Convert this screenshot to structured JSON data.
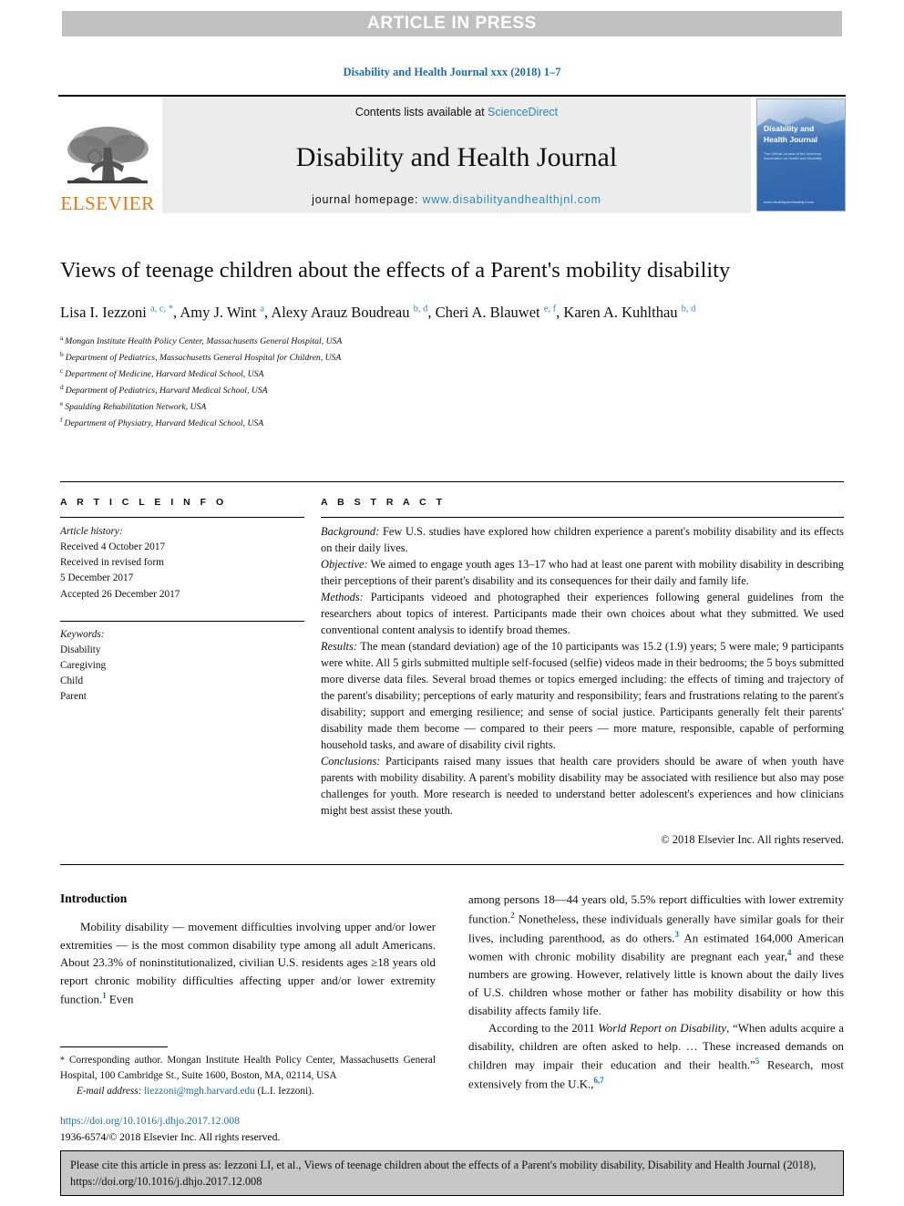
{
  "banner": {
    "label": "ARTICLE IN PRESS"
  },
  "running_head": {
    "text": "Disability and Health Journal xxx (2018) 1–7"
  },
  "masthead": {
    "publisher_name": "ELSEVIER",
    "contents_prefix": "Contents lists available at ",
    "contents_link": "ScienceDirect",
    "journal_name": "Disability and Health Journal",
    "homepage_prefix": "journal homepage: ",
    "homepage_url": "www.disabilityandhealthjnl.com",
    "cover": {
      "title_line1": "Disability and",
      "title_line2": "Health Journal",
      "subtitle": "The Official Journal of the American Association on Health and Disability",
      "footer": "www.disabilityandhealthjnl.com"
    },
    "accent_color": "#2b8ab5",
    "elsevier_orange": "#e77817"
  },
  "article": {
    "title": "Views of teenage children about the effects of a Parent's mobility disability",
    "authors_html": "Lisa I. Iezzoni <sup>a, c, *</sup>, Amy J. Wint <sup>a</sup>, Alexy Arauz Boudreau <sup>b, d</sup>, Cheri A. Blauwet <sup>e, f</sup>, Karen A. Kuhlthau <sup>b, d</sup>",
    "affiliations": [
      {
        "label": "a",
        "text": "Mongan Institute Health Policy Center, Massachusetts General Hospital, USA"
      },
      {
        "label": "b",
        "text": "Department of Pediatrics, Massachusetts General Hospital for Children, USA"
      },
      {
        "label": "c",
        "text": "Department of Medicine, Harvard Medical School, USA"
      },
      {
        "label": "d",
        "text": "Department of Pediatrics, Harvard Medical School, USA"
      },
      {
        "label": "e",
        "text": "Spaulding Rehabilitation Network, USA"
      },
      {
        "label": "f",
        "text": "Department of Physiatry, Harvard Medical School, USA"
      }
    ]
  },
  "article_info": {
    "heading": "A R T I C L E  I N F O",
    "history_label": "Article history:",
    "history": [
      "Received 4 October 2017",
      "Received in revised form",
      "5 December 2017",
      "Accepted 26 December 2017"
    ],
    "keywords_label": "Keywords:",
    "keywords": [
      "Disability",
      "Caregiving",
      "Child",
      "Parent"
    ]
  },
  "abstract": {
    "heading": "A B S T R A C T",
    "sections": [
      {
        "label": "Background:",
        "text": " Few U.S. studies have explored how children experience a parent's mobility disability and its effects on their daily lives."
      },
      {
        "label": "Objective:",
        "text": " We aimed to engage youth ages 13–17 who had at least one parent with mobility disability in describing their perceptions of their parent's disability and its consequences for their daily and family life."
      },
      {
        "label": "Methods:",
        "text": " Participants videoed and photographed their experiences following general guidelines from the researchers about topics of interest. Participants made their own choices about what they submitted. We used conventional content analysis to identify broad themes."
      },
      {
        "label": "Results:",
        "text": " The mean (standard deviation) age of the 10 participants was 15.2 (1.9) years; 5 were male; 9 participants were white. All 5 girls submitted multiple self-focused (selfie) videos made in their bedrooms; the 5 boys submitted more diverse data files. Several broad themes or topics emerged including: the effects of timing and trajectory of the parent's disability; perceptions of early maturity and responsibility; fears and frustrations relating to the parent's disability; support and emerging resilience; and sense of social justice. Participants generally felt their parents' disability made them become — compared to their peers — more mature, responsible, capable of performing household tasks, and aware of disability civil rights."
      },
      {
        "label": "Conclusions:",
        "text": " Participants raised many issues that health care providers should be aware of when youth have parents with mobility disability. A parent's mobility disability may be associated with resilience but also may pose challenges for youth. More research is needed to understand better adolescent's experiences and how clinicians might best assist these youth."
      }
    ],
    "copyright": "© 2018 Elsevier Inc. All rights reserved."
  },
  "body": {
    "intro_heading": "Introduction",
    "left_paragraph_html": "Mobility disability — movement difficulties involving upper and/or lower extremities — is the most common disability type among all adult Americans. About 23.3% of noninstitutionalized, civilian U.S. residents ages ≥18 years old report chronic mobility difficulties affecting upper and/or lower extremity function.<sup>1</sup> Even",
    "right_paragraph_1_html": "among persons 18—44 years old, 5.5% report difficulties with lower extremity function.<sup>2</sup> Nonetheless, these individuals generally have similar goals for their lives, including parenthood, as do others.<sup>3</sup> An estimated 164,000 American women with chronic mobility disability are pregnant each year,<sup>4</sup> and these numbers are growing. However, relatively little is known about the daily lives of U.S. children whose mother or father has mobility disability or how this disability affects family life.",
    "right_paragraph_2_html": "According to the 2011 <span class=\"ital\">World Report on Disability</span>, “When adults acquire a disability, children are often asked to help. … These increased demands on children may impair their education and their health.”<sup>5</sup> Research, most extensively from the U.K.,<sup>6,7</sup>"
  },
  "footnote": {
    "corresponding_html": "<span class=\"star\">*</span> Corresponding author. Mongan Institute Health Policy Center, Massachusetts General Hospital, 100 Cambridge St., Suite 1600, Boston, MA, 02114, USA",
    "email_label": "E-mail address:",
    "email": "liezzoni@mgh.harvard.edu",
    "email_suffix": "(L.I. Iezzoni).",
    "doi": "https://doi.org/10.1016/j.dhjo.2017.12.008",
    "issn_line": "1936-6574/© 2018 Elsevier Inc. All rights reserved."
  },
  "cite_footer": {
    "text": "Please cite this article in press as: Iezzoni LI, et al., Views of teenage children about the effects of a Parent's mobility disability, Disability and Health Journal (2018), https://doi.org/10.1016/j.dhjo.2017.12.008"
  }
}
